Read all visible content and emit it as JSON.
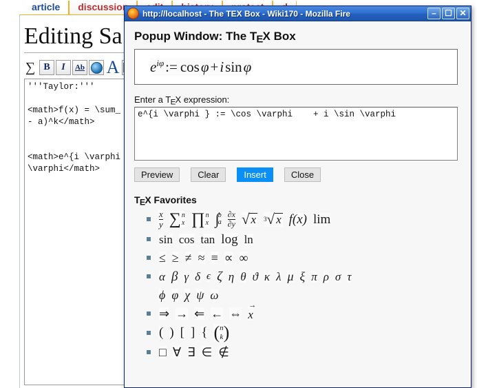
{
  "wiki": {
    "tabs": [
      {
        "label": "article",
        "active": true
      },
      {
        "label": "discussion",
        "active": false
      },
      {
        "label": "edit",
        "active": false
      },
      {
        "label": "history",
        "active": false
      },
      {
        "label": "protect",
        "active": false
      },
      {
        "label": "d",
        "active": false
      }
    ],
    "page_title": "Editing Sa",
    "toolbar_icons": [
      "sum-icon",
      "bold-icon",
      "italic-icon",
      "internal-link-icon",
      "external-link-icon",
      "big-a-icon",
      "image-icon"
    ],
    "editor_text": "'''Taylor:'''\n\n<math>f(x) = \\sum_\n- a)^k</math>\n\n\n<math>e^{i \\varphi\n\\varphi</math>",
    "right_edge_marks": [
      "t",
      "r"
    ]
  },
  "popup": {
    "titlebar": {
      "title": "http://localhost - The TEX Box - Wiki170 - Mozilla Fire",
      "icon": "firefox-icon",
      "minimize_label": "–",
      "maximize_label": "☐",
      "close_label": "✕"
    },
    "heading_prefix": "Popup Window: The T",
    "heading_e": "E",
    "heading_suffix": "X Box",
    "preview": {
      "base": "e",
      "exponent": "iφ",
      "assign": ":=",
      "rhs_cos": "cos",
      "rhs_phi1": "φ",
      "plus": "+",
      "rhs_i": "i",
      "rhs_sin": "sin",
      "rhs_phi2": "φ"
    },
    "entry_label_prefix": "Enter a T",
    "entry_label_e": "E",
    "entry_label_suffix": "X expression:",
    "tex_input_value": "e^{i \\varphi } := \\cos \\varphi    + i \\sin \\varphi",
    "buttons": [
      {
        "label": "Preview",
        "selected": false
      },
      {
        "label": "Clear",
        "selected": false
      },
      {
        "label": "Insert",
        "selected": true
      },
      {
        "label": "Close",
        "selected": false
      }
    ],
    "favorites_heading_prefix": "T",
    "favorites_heading_e": "E",
    "favorites_heading_suffix": "X Favorites",
    "favorites": {
      "row1": [
        "x/y fraction",
        "sum n x",
        "product n x",
        "integral a b",
        "partial dx/dy",
        "sqrt x",
        "cbrt x",
        "f(x)",
        "lim"
      ],
      "row2": [
        "sin",
        "cos",
        "tan",
        "log",
        "ln"
      ],
      "row3": [
        "≤",
        "≥",
        "≠",
        "≈",
        "≡",
        "∝",
        "∞"
      ],
      "row4": [
        "α",
        "β",
        "γ",
        "δ",
        "ϵ",
        "ζ",
        "η",
        "θ",
        "ϑ",
        "κ",
        "λ",
        "μ",
        "ξ",
        "π",
        "ρ",
        "σ",
        "τ"
      ],
      "row5": [
        "ϕ",
        "φ",
        "χ",
        "ψ",
        "ω"
      ],
      "row6": [
        "⇒",
        "→",
        "⇐",
        "←",
        "⇔",
        "vector x"
      ],
      "row7": [
        "(",
        ")",
        "[",
        "]",
        "{",
        "binom n k"
      ],
      "row8": [
        "□",
        "∀",
        "∃",
        "∈",
        "∉"
      ],
      "row2_labels": {
        "sin": "sin",
        "cos": "cos",
        "tan": "tan",
        "log": "log",
        "ln": "ln"
      },
      "row1_labels": {
        "frac_num": "x",
        "frac_den": "y",
        "sum": "∑",
        "sum_sup": "n",
        "sum_sub": "x",
        "prod": "∏",
        "prod_sup": "n",
        "prod_sub": "x",
        "int": "∫",
        "int_sup": "b",
        "int_sub": "a",
        "partial_num": "∂x",
        "partial_den": "∂y",
        "sqrt": "√",
        "sqrt_arg": "x",
        "cbrt_idx": "3",
        "cbrt": "√",
        "cbrt_arg": "x",
        "fx": "f(x)",
        "lim": "lim"
      },
      "row7_labels": {
        "binom_top": "n",
        "binom_bottom": "k",
        "lparen": "(",
        "rparen": ")"
      }
    }
  },
  "colors": {
    "titlebar_blue": "#2460bf",
    "selected_button": "#0a8ff6",
    "tab_active": "#1e4a9c",
    "tab_inactive": "#c03030",
    "bullet": "#5a7f96"
  }
}
